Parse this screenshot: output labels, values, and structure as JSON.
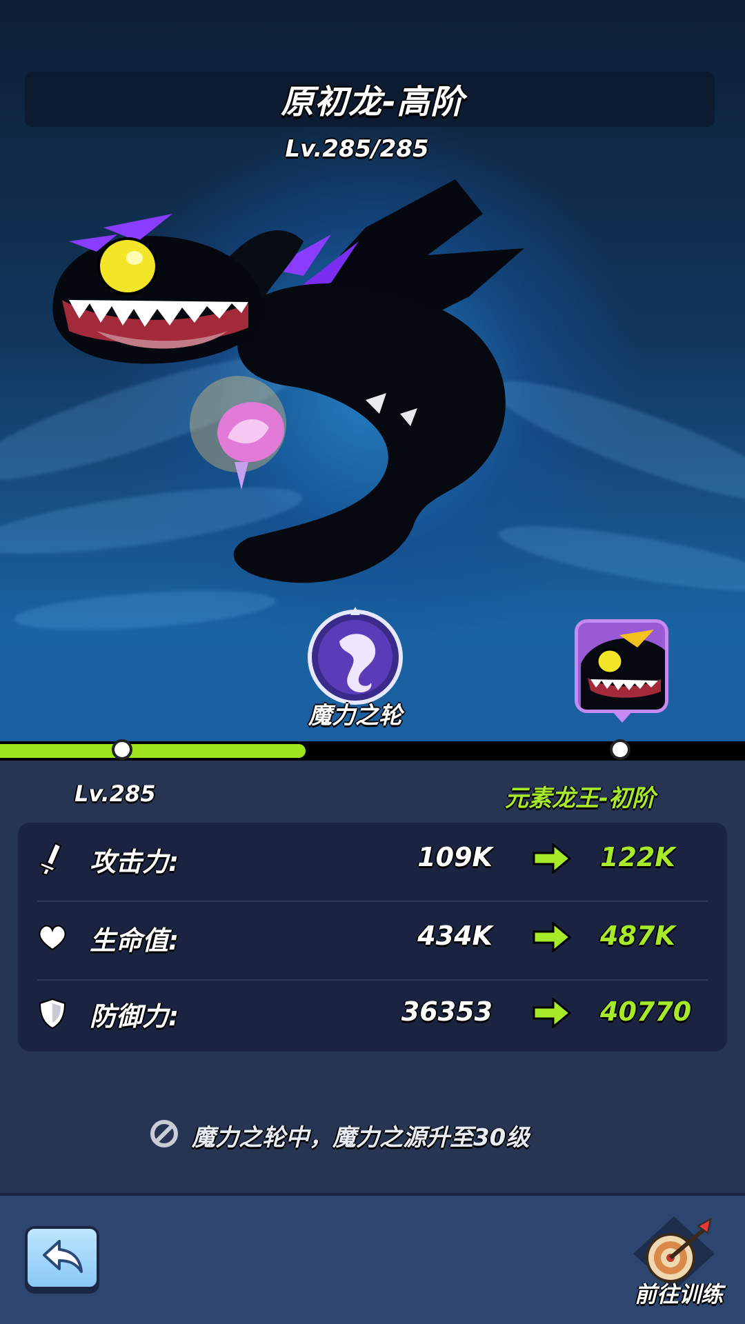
{
  "header": {
    "dragon_name": "原初龙-高阶",
    "level": "Lv.285/285"
  },
  "skill": {
    "name": "魔力之轮",
    "icon": "dragon-emblem-icon"
  },
  "progress": {
    "fill_fraction": 0.41,
    "current_level_label": "Lv.285",
    "next_form_name": "元素龙王-初阶"
  },
  "stats": [
    {
      "icon": "sword-icon",
      "label": "攻击力:",
      "current": "109K",
      "next": "122K"
    },
    {
      "icon": "heart-icon",
      "label": "生命值:",
      "current": "434K",
      "next": "487K"
    },
    {
      "icon": "shield-icon",
      "label": "防御力:",
      "current": "36353",
      "next": "40770"
    }
  ],
  "notice": {
    "icon": "prohibited-icon",
    "text": "魔力之轮中，魔力之源升至30级"
  },
  "footer": {
    "back_icon": "back-arrow-icon",
    "train_icon": "target-dart-icon",
    "train_label": "前往训练"
  },
  "colors": {
    "accent_green": "#a7ea2a",
    "panel_bg": "#273553",
    "portrait_purple": "#9a5ad6"
  }
}
